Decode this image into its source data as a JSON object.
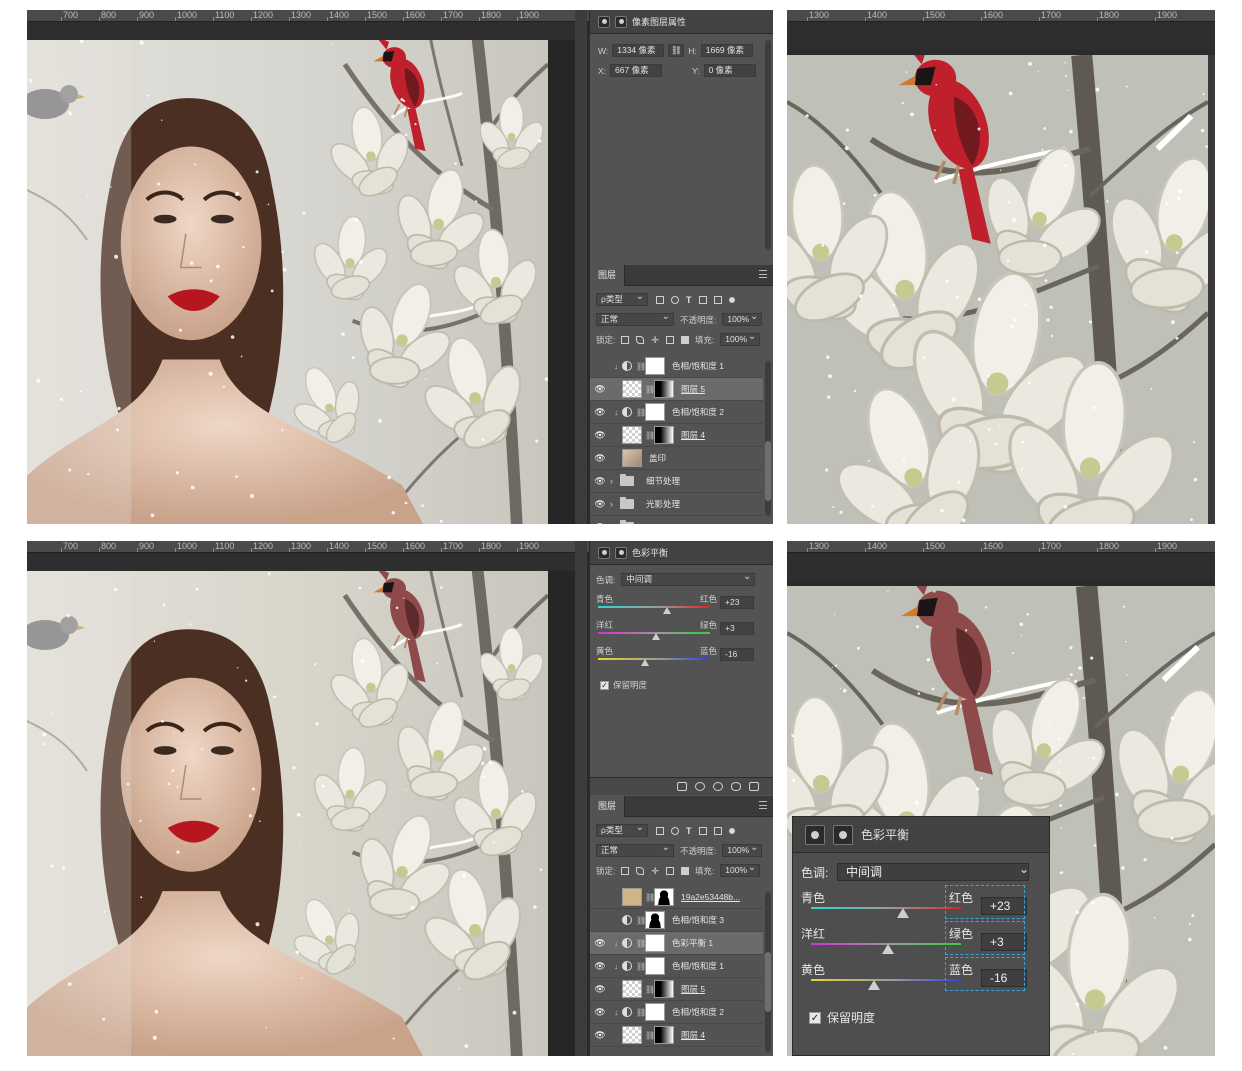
{
  "top_left": {
    "ruler": [
      "700",
      "800",
      "900",
      "1000",
      "1100",
      "1200",
      "1300",
      "1400",
      "1500",
      "1600",
      "1700",
      "1800",
      "1900"
    ],
    "properties": {
      "title": "像素图层属性",
      "w_label": "W:",
      "w_value": "1334 像素",
      "h_label": "H:",
      "h_value": "1669 像素",
      "x_label": "X:",
      "x_value": "667 像素",
      "y_label": "Y:",
      "y_value": "0 像素"
    },
    "layers": {
      "tab": "图层",
      "filter_kind": "ρ类型",
      "blend_mode": "正常",
      "opacity_label": "不透明度:",
      "opacity_value": "100%",
      "lock_label": "锁定:",
      "fill_label": "填充:",
      "fill_value": "100%",
      "rows": [
        {
          "name": "色相/饱和度 1",
          "visible": false,
          "type": "adj",
          "mask": "white",
          "clip": true,
          "selected": false,
          "underline": false
        },
        {
          "name": "图层 5",
          "visible": true,
          "type": "pixel",
          "thumb": "check",
          "mask": "grad",
          "clip": false,
          "selected": true,
          "underline": true
        },
        {
          "name": "色相/饱和度 2",
          "visible": true,
          "type": "adj",
          "mask": "white",
          "clip": true,
          "selected": false,
          "underline": false
        },
        {
          "name": "图层 4",
          "visible": true,
          "type": "pixel",
          "thumb": "check",
          "mask": "grad",
          "clip": false,
          "selected": false,
          "underline": true
        },
        {
          "name": "盖印",
          "visible": true,
          "type": "photo",
          "clip": false,
          "selected": false,
          "underline": false
        },
        {
          "name": "细节处理",
          "visible": true,
          "type": "group",
          "selected": false,
          "underline": false
        },
        {
          "name": "光影处理",
          "visible": true,
          "type": "group",
          "selected": false,
          "underline": false
        },
        {
          "name": "F S",
          "visible": true,
          "type": "group",
          "selected": false,
          "underline": false
        }
      ]
    }
  },
  "top_right": {
    "ruler": [
      "1300",
      "1400",
      "1500",
      "1600",
      "1700",
      "1800",
      "1900"
    ]
  },
  "bottom_left": {
    "ruler": [
      "700",
      "800",
      "900",
      "1000",
      "1100",
      "1200",
      "1300",
      "1400",
      "1500",
      "1600",
      "1700",
      "1800",
      "1900"
    ],
    "color_balance": {
      "title": "色彩平衡",
      "tone_label": "色调:",
      "tone_value": "中间调",
      "sliders": [
        {
          "left": "青色",
          "right": "红色",
          "value": "+23",
          "level": 23
        },
        {
          "left": "洋红",
          "right": "绿色",
          "value": "+3",
          "level": 3
        },
        {
          "left": "黄色",
          "right": "蓝色",
          "value": "-16",
          "level": -16
        }
      ],
      "preserve_label": "保留明度",
      "preserve_checked": true
    },
    "layers": {
      "tab": "图层",
      "filter_kind": "ρ类型",
      "blend_mode": "正常",
      "opacity_label": "不透明度:",
      "opacity_value": "100%",
      "lock_label": "锁定:",
      "fill_label": "填充:",
      "fill_value": "100%",
      "rows": [
        {
          "name": "19a2e53448b...",
          "visible": false,
          "type": "pixel",
          "thumb": "tan",
          "mask": "person",
          "clip": false,
          "selected": false,
          "underline": true
        },
        {
          "name": "色相/饱和度 3",
          "visible": false,
          "type": "adj",
          "mask": "person",
          "clip": false,
          "selected": false,
          "underline": false
        },
        {
          "name": "色彩平衡 1",
          "visible": true,
          "type": "adj",
          "mask": "white",
          "clip": true,
          "selected": true,
          "underline": false
        },
        {
          "name": "色相/饱和度 1",
          "visible": true,
          "type": "adj",
          "mask": "white",
          "clip": true,
          "selected": false,
          "underline": false
        },
        {
          "name": "图层 5",
          "visible": true,
          "type": "pixel",
          "thumb": "check",
          "mask": "grad",
          "clip": false,
          "selected": false,
          "underline": true
        },
        {
          "name": "色相/饱和度 2",
          "visible": true,
          "type": "adj",
          "mask": "white",
          "clip": true,
          "selected": false,
          "underline": false
        },
        {
          "name": "图层 4",
          "visible": true,
          "type": "pixel",
          "thumb": "check",
          "mask": "grad",
          "clip": false,
          "selected": false,
          "underline": true
        }
      ]
    }
  },
  "bottom_right": {
    "ruler": [
      "1300",
      "1400",
      "1500",
      "1600",
      "1700",
      "1800",
      "1900"
    ],
    "color_balance": {
      "title": "色彩平衡",
      "tone_label": "色调:",
      "tone_value": "中间调",
      "sliders": [
        {
          "left": "青色",
          "right": "红色",
          "value": "+23",
          "level": 23
        },
        {
          "left": "洋红",
          "right": "绿色",
          "value": "+3",
          "level": 3
        },
        {
          "left": "黄色",
          "right": "蓝色",
          "value": "-16",
          "level": -16
        }
      ],
      "preserve_label": "保留明度",
      "preserve_checked": true
    }
  },
  "icons": {
    "eye": "eye-icon",
    "link": "link-icon",
    "clip": "clip-icon",
    "folder": "folder-icon",
    "adjustment": "adjustment-layer-icon",
    "balance": "scale-icon",
    "mask": "mask-icon"
  },
  "colors": {
    "panel_bg": "#535353",
    "header_bg": "#424242",
    "canvas_bg": "#2b2b2b",
    "highlight": "#31a7e5",
    "cardinal_red": "#c0202c",
    "cardinal_muted": "#8e4a4a",
    "lips": "#b8161f"
  }
}
